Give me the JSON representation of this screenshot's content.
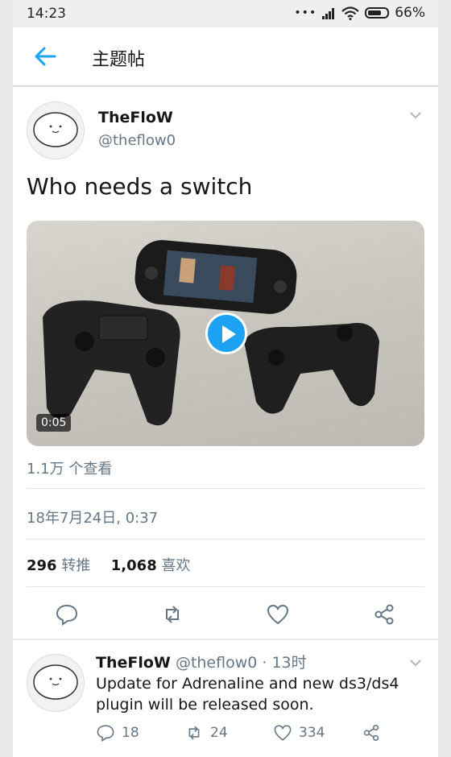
{
  "status_bar": {
    "time": "14:23",
    "dots": "•••",
    "battery": "66%"
  },
  "header": {
    "title": "主题帖"
  },
  "tweet": {
    "author_name": "TheFloW",
    "author_handle": "@theflow0",
    "text": "Who needs a switch",
    "video_duration": "0:05",
    "views": "1.1万 个查看",
    "timestamp": "18年7月24日, 0:37",
    "retweets_count": "296",
    "retweets_label": "转推",
    "likes_count": "1,068",
    "likes_label": "喜欢"
  },
  "reply": {
    "author_name": "TheFloW",
    "author_handle": "@theflow0",
    "time_ago": "· 13时",
    "text": "Update for Adrenaline and new ds3/ds4 plugin will be released soon.",
    "reply_count": "18",
    "retweet_count": "24",
    "like_count": "334"
  },
  "colors": {
    "accent": "#1da1f2",
    "secondary_text": "#657786",
    "primary_text": "#14171a"
  },
  "icons": [
    "back-arrow-icon",
    "chevron-down-icon",
    "play-icon",
    "reply-icon",
    "retweet-icon",
    "like-icon",
    "share-icon"
  ]
}
